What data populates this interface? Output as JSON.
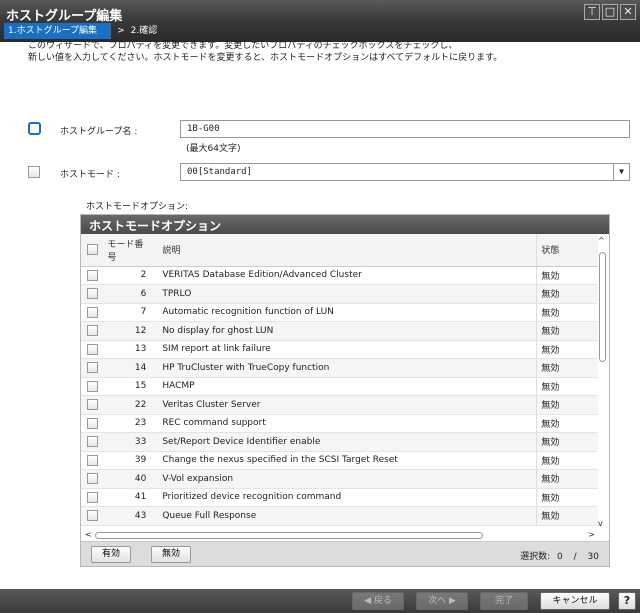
{
  "window": {
    "title": "ホストグループ編集",
    "buttons": [
      "⊤",
      "□",
      "✕"
    ]
  },
  "steps": {
    "active": "1.ホストグループ編集",
    "separator": ">",
    "next": "2.確認"
  },
  "intro": {
    "line1": "このウィザードで、プロパティを変更できます。変更したいプロパティのチェックボックスをチェックし、",
    "line2": "新しい値を入力してください。ホストモードを変更すると、ホストモードオプションはすべてデフォルトに戻ります。"
  },
  "host_group_name": {
    "label": "ホストグループ名 :",
    "value": "1B-G00",
    "hint": "(最大64文字)"
  },
  "host_mode": {
    "label": "ホストモード :",
    "value": "00[Standard]"
  },
  "options": {
    "label": "ホストモードオプション:",
    "panel_title": "ホストモードオプション",
    "columns": {
      "no": "モード番号",
      "desc": "説明",
      "status": "状態"
    },
    "rows": [
      {
        "no": "2",
        "desc": "VERITAS Database Edition/Advanced Cluster",
        "status": "無効"
      },
      {
        "no": "6",
        "desc": "TPRLO",
        "status": "無効"
      },
      {
        "no": "7",
        "desc": "Automatic recognition function of LUN",
        "status": "無効"
      },
      {
        "no": "12",
        "desc": "No display for ghost LUN",
        "status": "無効"
      },
      {
        "no": "13",
        "desc": "SIM report at link failure",
        "status": "無効"
      },
      {
        "no": "14",
        "desc": "HP TruCluster with TrueCopy function",
        "status": "無効"
      },
      {
        "no": "15",
        "desc": "HACMP",
        "status": "無効"
      },
      {
        "no": "22",
        "desc": "Veritas Cluster Server",
        "status": "無効"
      },
      {
        "no": "23",
        "desc": "REC command support",
        "status": "無効"
      },
      {
        "no": "33",
        "desc": "Set/Report Device Identifier enable",
        "status": "無効"
      },
      {
        "no": "39",
        "desc": "Change the nexus specified in the SCSI Target Reset",
        "status": "無効"
      },
      {
        "no": "40",
        "desc": "V-Vol expansion",
        "status": "無効"
      },
      {
        "no": "41",
        "desc": "Prioritized device recognition command",
        "status": "無効"
      },
      {
        "no": "43",
        "desc": "Queue Full Response",
        "status": "無効"
      }
    ],
    "enable_button": "有効",
    "disable_button": "無効",
    "selection_label": "選択数:",
    "selected": "0",
    "total": "30"
  },
  "footer": {
    "back": "◀ 戻る",
    "next": "次へ ▶",
    "finish": "完了",
    "cancel": "キャンセル",
    "help": "?"
  }
}
